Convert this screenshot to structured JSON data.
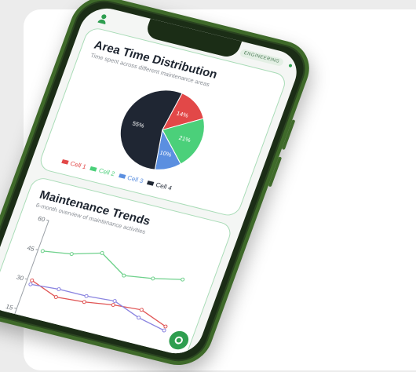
{
  "header": {
    "tag": "ENGINEERING"
  },
  "colors": {
    "accent": "#2e9e4f",
    "frame": "#3f6a2a",
    "panel_border": "#a9dcb7"
  },
  "area_panel": {
    "title": "Area Time Distribution",
    "subtitle": "Time spent across different maintenance areas"
  },
  "trends_panel": {
    "title": "Maintenance Trends",
    "subtitle": "6-month overview of maintenance activities"
  },
  "icons": {
    "user": "user-icon",
    "fab": "settings-icon"
  },
  "chart_data": [
    {
      "type": "pie",
      "title": "Area Time Distribution",
      "labels": [
        "Cell 1",
        "Cell 2",
        "Cell 3",
        "Cell 4"
      ],
      "values": [
        14,
        21,
        10,
        55
      ],
      "value_labels": [
        "14%",
        "21%",
        "10%",
        "55%"
      ],
      "colors": [
        "#e24848",
        "#4bd07a",
        "#5b8fe0",
        "#1f2633"
      ],
      "legend": "bottom"
    },
    {
      "type": "line",
      "title": "Maintenance Trends",
      "x": [
        1,
        2,
        3,
        4,
        5,
        6
      ],
      "yticks": [
        "60",
        "45",
        "30",
        "15"
      ],
      "ylim": [
        10,
        60
      ],
      "series": [
        {
          "values": [
            45,
            47,
            51,
            43,
            45,
            48
          ],
          "color": "#6fd18c"
        },
        {
          "values": [
            30,
            25,
            26,
            28,
            29,
            24
          ],
          "color": "#e05555"
        },
        {
          "values": [
            28,
            29,
            29,
            30,
            25,
            22
          ],
          "color": "#8a84e0"
        }
      ]
    }
  ]
}
